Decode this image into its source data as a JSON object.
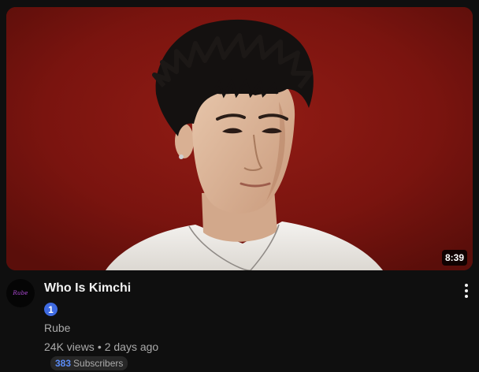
{
  "video": {
    "title": "Who Is Kimchi",
    "duration": "8:39",
    "badge_number": "1",
    "channel": {
      "name": "Rube",
      "avatar_text": "Rube"
    },
    "views": "24K views",
    "separator": "•",
    "age": "2 days ago",
    "subscribers": {
      "count": "383",
      "label": "Subscribers"
    }
  },
  "icons": {
    "menu": "more-vert-icon",
    "badge": "number-badge-icon"
  },
  "colors": {
    "background": "#0f0f0f",
    "thumbnail_backdrop": "#7b1510",
    "badge": "#3e6ae1",
    "subscriber_count": "#5b8cf7",
    "avatar_text": "#b04bd8"
  }
}
